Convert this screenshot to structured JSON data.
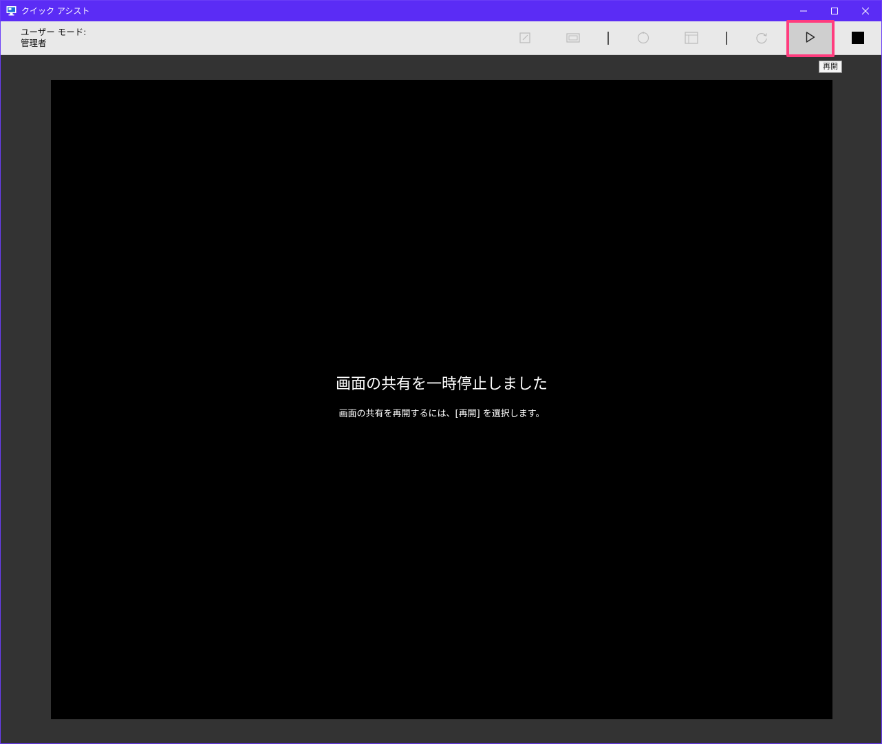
{
  "window": {
    "title": "クイック アシスト",
    "icon": "monitor-icon",
    "controls": [
      "minimize-icon",
      "maximize-icon",
      "close-icon"
    ]
  },
  "toolbar": {
    "user_mode_label": "ユーザー モード:",
    "user_mode_value": "管理者",
    "tools": [
      {
        "name": "annotate-icon",
        "enabled": false
      },
      {
        "name": "screen-icon",
        "enabled": false
      },
      {
        "name": "laser-pointer-icon",
        "enabled": false
      },
      {
        "name": "task-manager-icon",
        "enabled": false
      },
      {
        "name": "restart-icon",
        "enabled": false
      }
    ],
    "resume_icon": "play-icon",
    "stop_icon": "stop-icon",
    "resume_tooltip": "再開"
  },
  "main": {
    "paused_title": "画面の共有を一時停止しました",
    "paused_subtitle": "画面の共有を再開するには、[再開] を選択します。"
  },
  "colors": {
    "title_bar": "#5b2cf5",
    "highlight": "#ff3c7e",
    "workspace": "#333333",
    "screen": "#000000"
  }
}
